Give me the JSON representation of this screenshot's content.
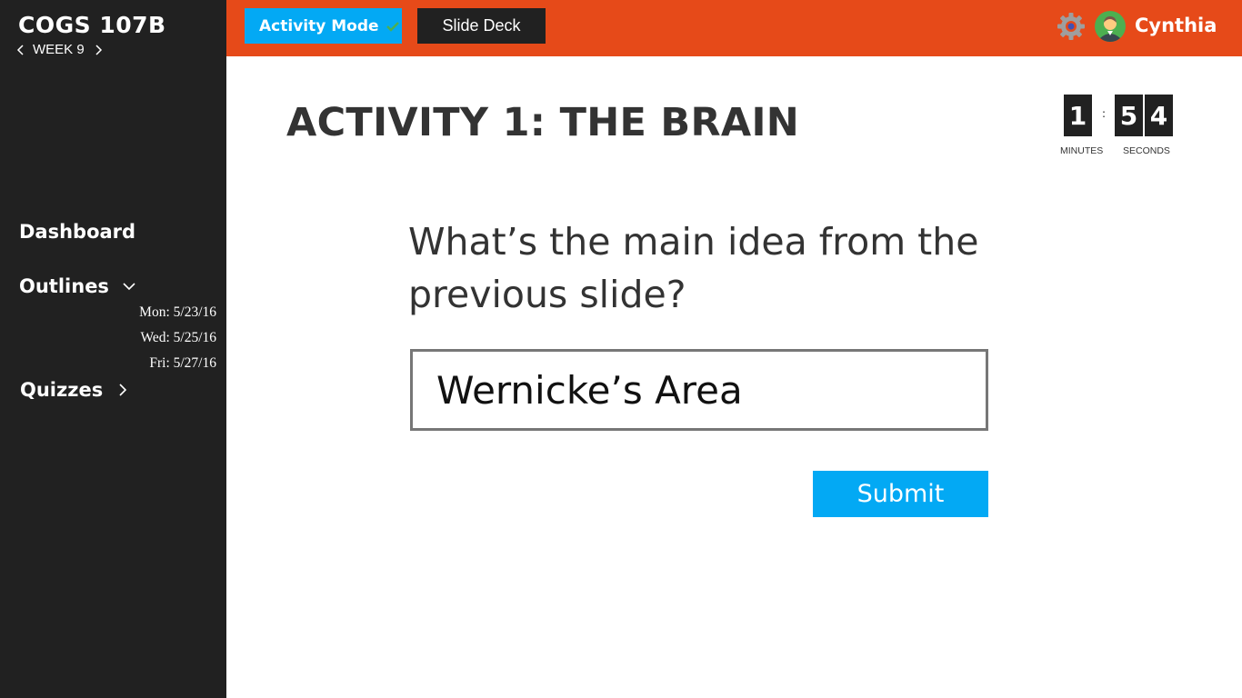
{
  "sidebar": {
    "course_title": "COGS 107B",
    "week_label": "WEEK 9",
    "nav": {
      "dashboard": "Dashboard",
      "outlines": "Outlines",
      "quizzes": "Quizzes"
    },
    "outline_dates": [
      "Mon: 5/23/16",
      "Wed: 5/25/16",
      "Fri: 5/27/16"
    ]
  },
  "topbar": {
    "activity_mode_label": "Activity Mode",
    "slide_deck_label": "Slide Deck",
    "user_name": "Cynthia",
    "icons": [
      "gear-icon",
      "avatar-icon",
      "checkmark-icon"
    ]
  },
  "main": {
    "activity_title": "ACTIVITY 1: THE BRAIN",
    "timer": {
      "minutes": "1",
      "seconds_tens": "5",
      "seconds_ones": "4",
      "minutes_label": "MINUTES",
      "seconds_label": "SECONDS"
    },
    "question": "What’s the main idea from the previous slide?",
    "answer_value": "Wernicke’s Area",
    "submit_label": "Submit"
  },
  "colors": {
    "topbar": "#e64a19",
    "sidebar": "#212121",
    "accent": "#03a9f4",
    "check": "#4caf50"
  }
}
